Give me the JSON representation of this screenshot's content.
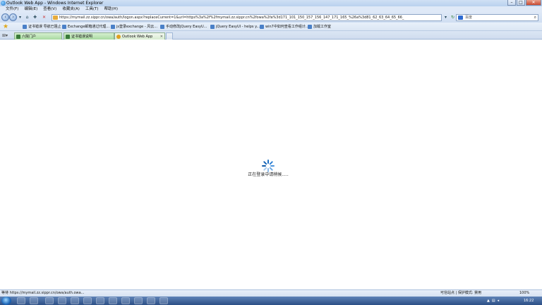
{
  "window": {
    "title": "Outlook Web App - Windows Internet Explorer"
  },
  "menu": [
    "文件(F)",
    "编辑(E)",
    "查看(V)",
    "收藏夹(A)",
    "工具(T)",
    "帮助(H)"
  ],
  "address_bar": {
    "url": "https://mymail.zz.sippr.cn/owa/auth/logon.aspx?replaceCurrent=1&url=https%3a%2f%2fmymail.zz.sippr.cn%2fowa%2fa%3d171_101_150_157_156_147_171_165_%26a%3d81_62_63_64_65_66_",
    "search_placeholder": "百度"
  },
  "favorites": [
    {
      "label": "证书错误 导航已阻止"
    },
    {
      "label": "Exchange邮箱通过代理..."
    },
    {
      "label": "js登录exchange - 风云..."
    },
    {
      "label": "手动修改jQuery EasyU..."
    },
    {
      "label": "jQuery EasyUI - helps y..."
    },
    {
      "label": "win7中如何查看工作组计..."
    },
    {
      "label": "加载工作室"
    }
  ],
  "tabs": [
    {
      "label": "六院门户"
    },
    {
      "label": "证书错误说明"
    },
    {
      "label": "Outlook Web App",
      "active": true
    }
  ],
  "content": {
    "loading_text": "正在登录中请稍候....."
  },
  "status": {
    "left": "等待 https://mymail.zz.sippr.cn/owa/auth.owa...",
    "right": "可信站点 | 保护模式: 禁用",
    "zoom": "100%"
  },
  "taskbar": {
    "clock": "16:22"
  }
}
